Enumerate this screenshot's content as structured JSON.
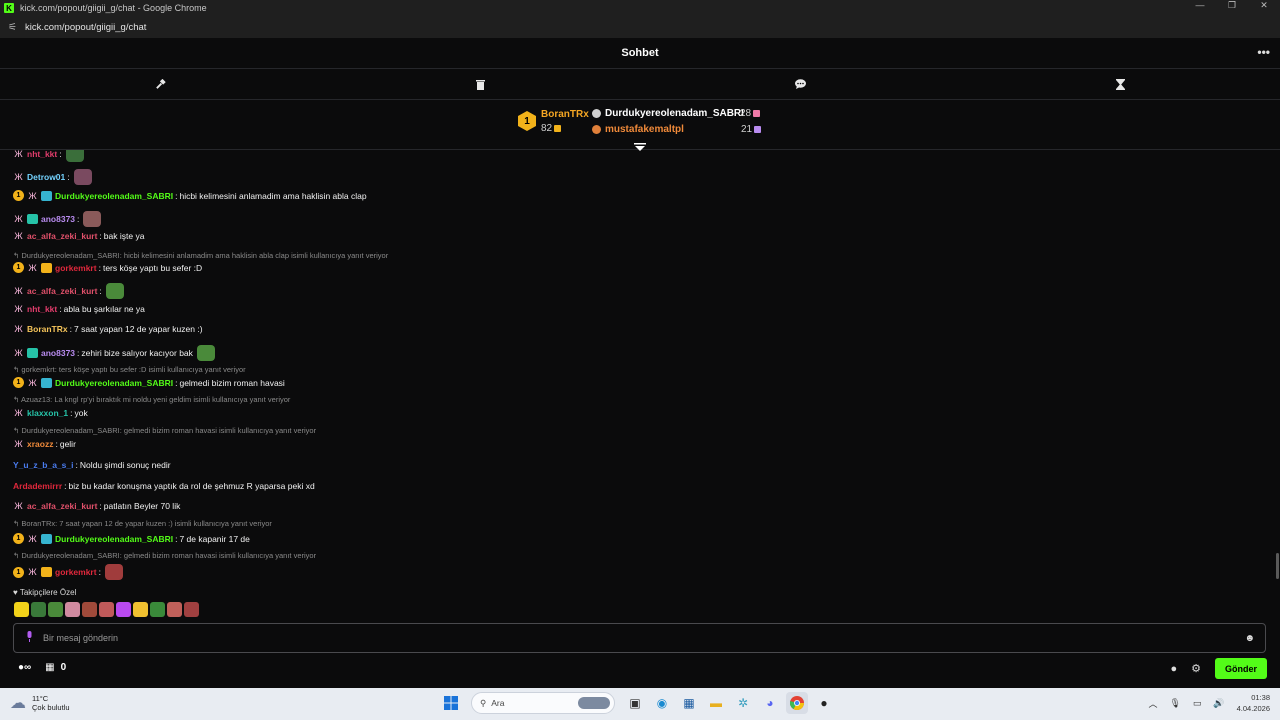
{
  "window": {
    "title": "kick.com/popout/giigii_g/chat - Google Chrome",
    "url": "kick.com/popout/giigii_g/chat",
    "controls": [
      "—",
      "❐",
      "✕"
    ]
  },
  "header": {
    "title": "Sohbet",
    "more_label": "•••"
  },
  "toolbar": {
    "icons": [
      "hammer-icon",
      "trash-icon",
      "chat-bubble-icon",
      "hourglass-icon"
    ]
  },
  "leaderboard": {
    "first": {
      "rank": "1",
      "name": "BoranTRx",
      "count": "82"
    },
    "second": {
      "name": "Durdukyereolenadam_SABRI",
      "count": "28"
    },
    "third": {
      "name": "mustafakemaltpl",
      "count": "21"
    }
  },
  "messages": [
    {
      "user": "nht_kkt",
      "color": "#e03c6b",
      "text": "",
      "emote": "#3a6e3a",
      "clipped": true
    },
    {
      "user": "Detrow01",
      "color": "#74d3ff",
      "text": "",
      "emote": "#7a4a60"
    },
    {
      "user": "Durdukyereolenadam_SABRI",
      "color": "#53fc18",
      "text": "hicbi kelimesini anlamadim ama haklisin abla clap",
      "coin": true,
      "sub": "#36b4d0"
    },
    {
      "user": "ano8373",
      "color": "#b98cf0",
      "text": "",
      "sub": "#26c3a8",
      "emote": "#8a5a5a"
    },
    {
      "user": "ac_alfa_zeki_kurt",
      "color": "#e0506a",
      "text": "bak işte ya"
    },
    {
      "reply": "Durdukyereolenadam_SABRI: hicbi kelimesini anlamadim ama haklisin abla clap isimli kullanıcıya yanıt veriyor"
    },
    {
      "user": "gorkemkrt",
      "color": "#e0283c",
      "text": "ters köşe yaptı bu sefer :D",
      "coin": true,
      "sub": "#f2b21a"
    },
    {
      "user": "ac_alfa_zeki_kurt",
      "color": "#e0506a",
      "text": "",
      "emote": "#4a8a3a"
    },
    {
      "user": "nht_kkt",
      "color": "#e03c6b",
      "text": "abla bu şarkılar ne ya"
    },
    {
      "user": "BoranTRx",
      "color": "#f5c45a",
      "text": "7 saat yapan 12 de yapar kuzen :)"
    },
    {
      "user": "ano8373",
      "color": "#b98cf0",
      "text": "zehiri bize salıyor kacıyor bak",
      "sub": "#26c3a8",
      "emote": "#4a8a3a"
    },
    {
      "reply": "gorkemkrt: ters köşe yaptı bu sefer :D isimli kullanıcıya yanıt veriyor"
    },
    {
      "user": "Durdukyereolenadam_SABRI",
      "color": "#53fc18",
      "text": "gelmedi bizim roman havasi",
      "coin": true,
      "sub": "#36b4d0"
    },
    {
      "reply": "Azuaz13: La kngl rp'yi bıraktık mi noldu yeni geldim isimli kullanıcıya yanıt veriyor"
    },
    {
      "user": "klaxxon_1",
      "color": "#26c3a8",
      "text": "yok"
    },
    {
      "reply": "Durdukyereolenadam_SABRI: gelmedi bizim roman havasi isimli kullanıcıya yanıt veriyor"
    },
    {
      "user": "xraozz",
      "color": "#f08a3a",
      "text": "gelir"
    },
    {
      "user": "Y_u_z_b_a_s_i",
      "color": "#4a7cf0",
      "text": "Noldu şimdi sonuç nedir",
      "nobadge": true
    },
    {
      "user": "Ardademirrr",
      "color": "#e0283c",
      "text": "biz bu kadar konuşma yaptık da rol de şehmuz R yaparsa peki xd",
      "nobadge": true
    },
    {
      "user": "ac_alfa_zeki_kurt",
      "color": "#e0506a",
      "text": "patlatın Beyler 70 lik"
    },
    {
      "reply": "BoranTRx: 7 saat yapan 12 de yapar kuzen :) isimli kullanıcıya yanıt veriyor"
    },
    {
      "user": "Durdukyereolenadam_SABRI",
      "color": "#53fc18",
      "text": "7 de kapanir 17 de",
      "coin": true,
      "sub": "#36b4d0"
    },
    {
      "reply": "Durdukyereolenadam_SABRI: gelmedi bizim roman havasi isimli kullanıcıya yanıt veriyor"
    },
    {
      "user": "gorkemkrt",
      "color": "#e0283c",
      "text": "",
      "coin": true,
      "sub": "#f2b21a",
      "emote": "#a03c3c"
    }
  ],
  "followers_label": "Takipçilere Özel",
  "emote_bar": [
    "#f2d21a",
    "#3a7a3a",
    "#4a8a3a",
    "#d08aa0",
    "#a04a3a",
    "#c05a5a",
    "#b94af0",
    "#f0c030",
    "#3a8a3a",
    "#c0605a",
    "#a04040"
  ],
  "input": {
    "placeholder": "Bir mesaj gönderin"
  },
  "bottom": {
    "points": "0",
    "send_label": "Gönder"
  },
  "taskbar": {
    "temp": "11°C",
    "weather": "Çok bulutlu",
    "search": "Ara",
    "time": "01:38",
    "date": "4.04.2026"
  }
}
